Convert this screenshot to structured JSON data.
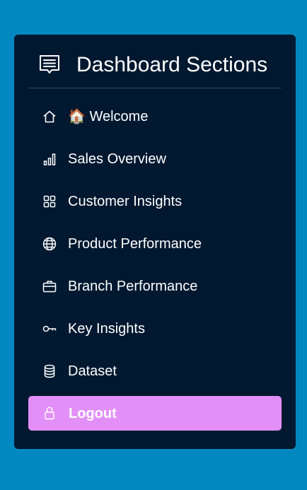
{
  "sidebar": {
    "title": "Dashboard Sections",
    "items": [
      {
        "label": "🏠 Welcome",
        "icon": "home-icon"
      },
      {
        "label": "Sales Overview",
        "icon": "bar-chart-icon"
      },
      {
        "label": "Customer Insights",
        "icon": "grid-icon"
      },
      {
        "label": "Product Performance",
        "icon": "globe-icon"
      },
      {
        "label": "Branch Performance",
        "icon": "briefcase-icon"
      },
      {
        "label": "Key Insights",
        "icon": "key-icon"
      },
      {
        "label": "Dataset",
        "icon": "database-icon"
      }
    ],
    "logout": {
      "label": "Logout",
      "icon": "lock-icon"
    }
  },
  "colors": {
    "background": "#0288c1",
    "panel": "#001830",
    "logout": "#e28ff8"
  }
}
